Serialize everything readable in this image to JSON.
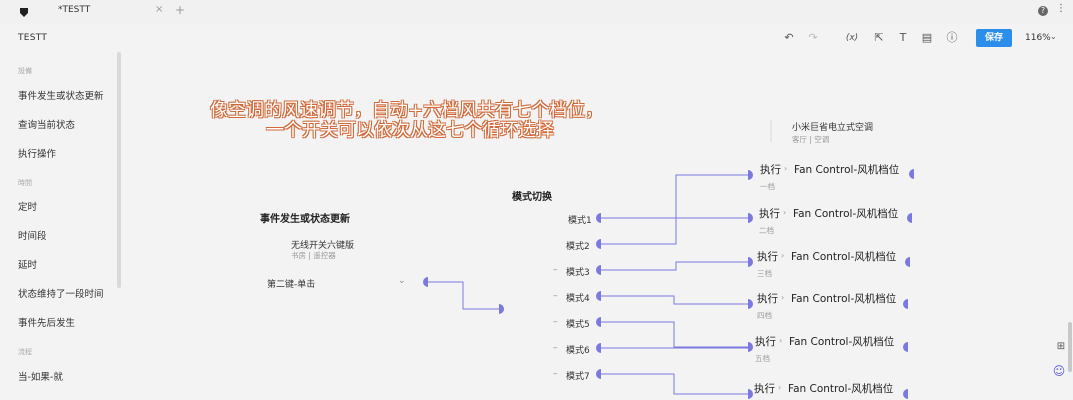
{
  "tab": {
    "title": "*TESTT",
    "close": "×",
    "add": "+"
  },
  "header": {
    "title": "TESTT",
    "save_label": "保存",
    "zoom": "116%"
  },
  "sidebar": {
    "sections": [
      {
        "label": "設備",
        "items": [
          "事件发生或状态更新",
          "查询当前状态",
          "执行操作"
        ]
      },
      {
        "label": "時間",
        "items": [
          "定时",
          "时间段",
          "延时",
          "状态维持了一段时间",
          "事件先后发生"
        ]
      },
      {
        "label": "流程",
        "items": [
          "当-如果-就"
        ]
      }
    ]
  },
  "note": {
    "line1": "像空调的风速调节，自动+六档风共有七个档位，",
    "line2": "一个开关可以依次从这七个循环选择"
  },
  "device_card": {
    "name": "小米巨省电立式空调",
    "location": "客厅 | 空调"
  },
  "trigger": {
    "title": "事件发生或状态更新",
    "device": "无线开关六键版",
    "device_location": "书房 | 遥控器",
    "event": "第二键-单击"
  },
  "mode_switch": {
    "title": "模式切换",
    "modes": [
      "模式1",
      "模式2",
      "模式3",
      "模式4",
      "模式5",
      "模式6",
      "模式7"
    ]
  },
  "actions": [
    {
      "label": "执行",
      "target": "Fan Control-风机档位",
      "value": "一档"
    },
    {
      "label": "执行",
      "target": "Fan Control-风机档位",
      "value": "二档"
    },
    {
      "label": "执行",
      "target": "Fan Control-风机档位",
      "value": "三档"
    },
    {
      "label": "执行",
      "target": "Fan Control-风机档位",
      "value": "四档"
    },
    {
      "label": "执行",
      "target": "Fan Control-风机档位",
      "value": "五档"
    },
    {
      "label": "执行",
      "target": "Fan Control-风机档位",
      "value": ""
    }
  ],
  "colors": {
    "accent": "#2a8eea",
    "connector": "#7b79e0",
    "note_outline": "#d06a3a"
  }
}
